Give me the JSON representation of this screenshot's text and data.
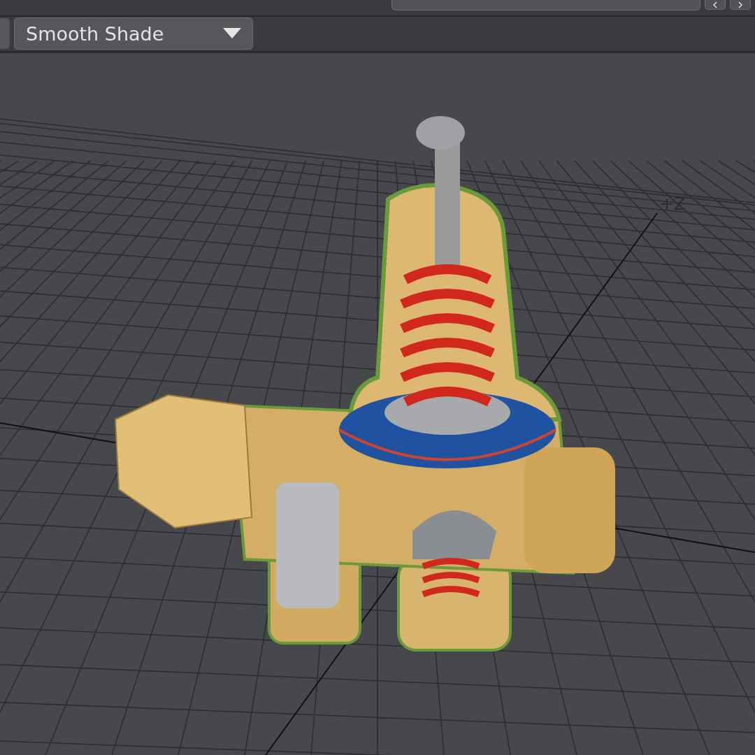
{
  "toolbar": {
    "shading_mode": "Smooth Shade"
  },
  "viewport": {
    "axis_label": "+Z"
  }
}
